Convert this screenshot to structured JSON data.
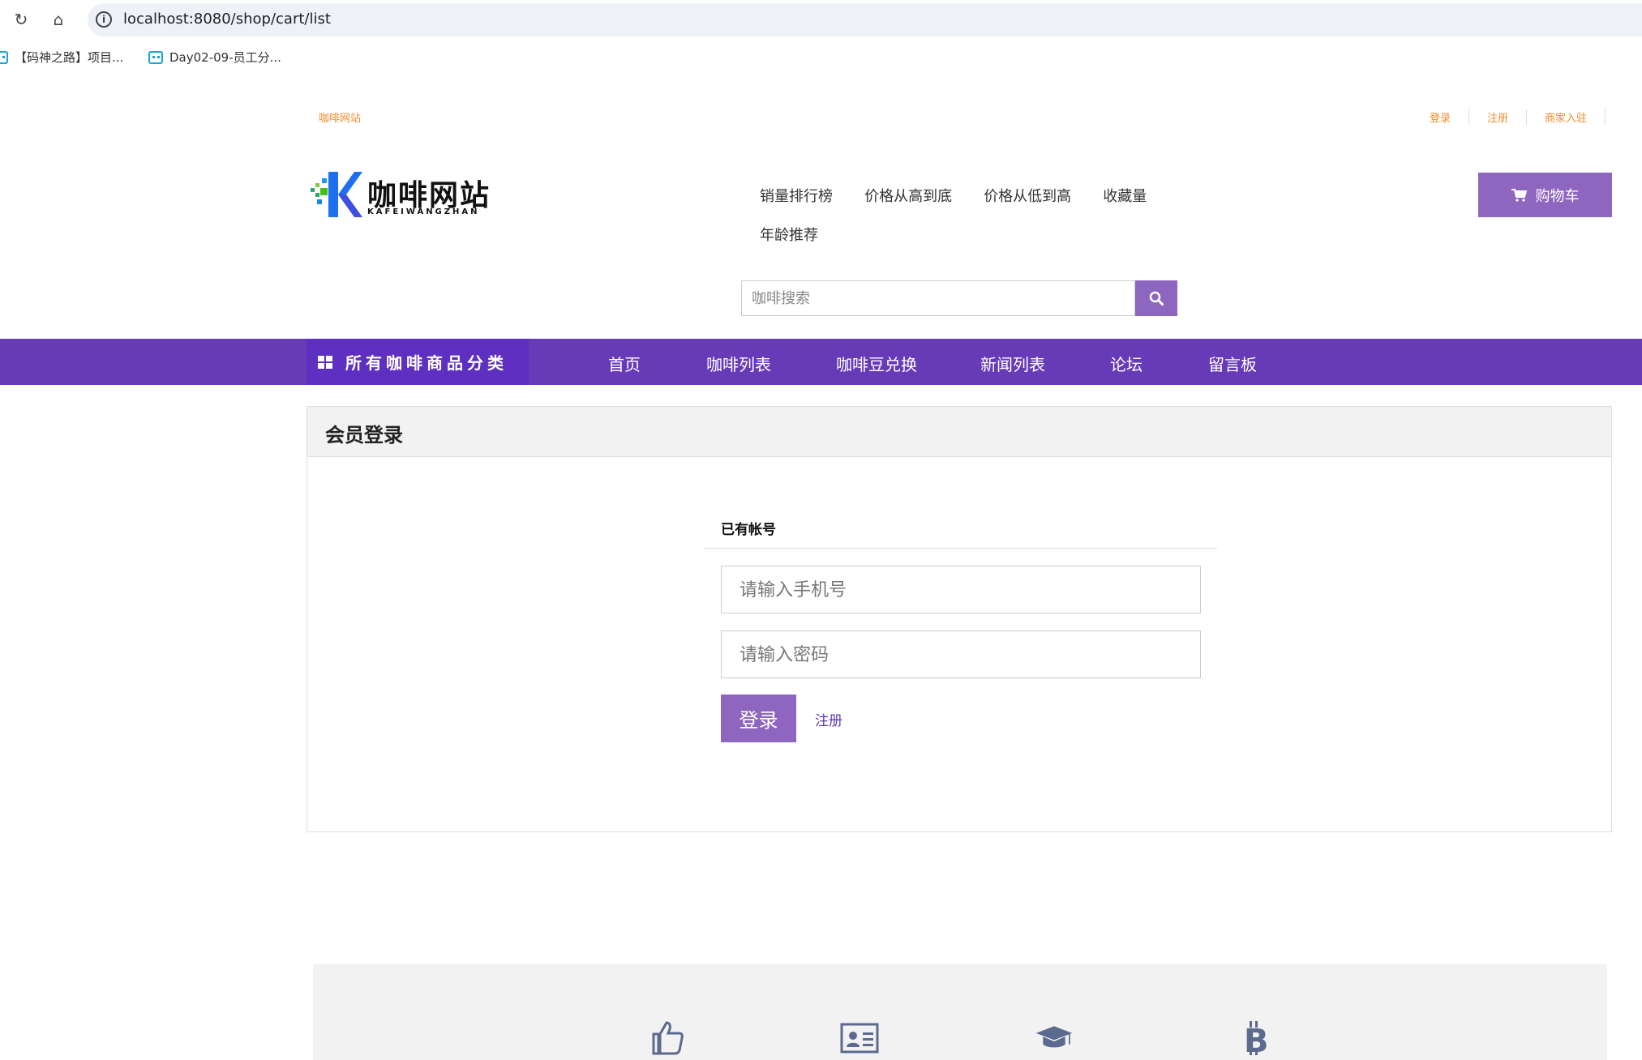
{
  "browser": {
    "url": "localhost:8080/shop/cart/list",
    "bookmarks": [
      "【码神之路】项目...",
      "Day02-09-员工分..."
    ]
  },
  "topbar": {
    "site_name": "咖啡网站",
    "links": [
      "登录",
      "注册",
      "商家入驻"
    ]
  },
  "logo": {
    "title": "咖啡网站",
    "subtitle": "KAFEIWANGZHAN"
  },
  "sort_nav": [
    "销量排行榜",
    "价格从高到底",
    "价格从低到高",
    "收藏量",
    "年龄推荐"
  ],
  "cart": {
    "label": "购物车",
    "icon": "cart-icon"
  },
  "search": {
    "placeholder": "咖啡搜索",
    "icon": "search-icon"
  },
  "main_nav": {
    "category_label": "所有咖啡商品分类",
    "items": [
      "首页",
      "咖啡列表",
      "咖啡豆兑换",
      "新闻列表",
      "论坛",
      "留言板"
    ]
  },
  "login_panel": {
    "heading": "会员登录",
    "subheading": "已有帐号",
    "phone_placeholder": "请输入手机号",
    "password_placeholder": "请输入密码",
    "submit_label": "登录",
    "register_label": "注册"
  },
  "footer": {
    "icons": [
      "thumbs-up-icon",
      "id-card-icon",
      "graduation-cap-icon",
      "bitcoin-icon"
    ]
  },
  "colors": {
    "accent": "#8e66bf",
    "nav": "#673ab7",
    "top_link": "#f28b30"
  }
}
